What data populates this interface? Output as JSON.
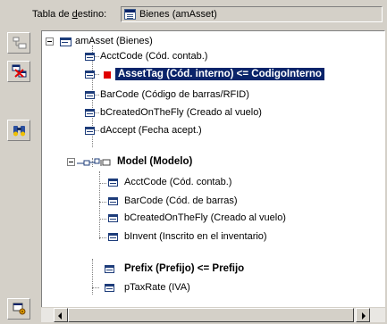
{
  "target": {
    "label_prefix": "Tabla de ",
    "label_underlined": "d",
    "label_suffix": "estino:",
    "value": "Bienes (amAsset)",
    "icon": "table-icon"
  },
  "toolbar": [
    {
      "name": "tree-view-button",
      "icon": "tree-icon"
    },
    {
      "name": "remove-link-button",
      "icon": "remove-icon"
    },
    {
      "name": "find-button",
      "icon": "binoculars-icon"
    },
    {
      "name": "bottom-tool-button",
      "icon": "tool-icon"
    }
  ],
  "tree": {
    "root": "amAsset (Bienes)",
    "fields": [
      "AcctCode (Cód. contab.)",
      "AssetTag (Cód. interno)  <=  CodigoInterno",
      "BarCode (Código de barras/RFID)",
      "bCreatedOnTheFly (Creado al vuelo)",
      "dAccept (Fecha acept.)"
    ],
    "model_link": "Model (Modelo)",
    "model_fields": [
      "AcctCode (Cód. contab.)",
      "BarCode (Cód. de barras)",
      "bCreatedOnTheFly (Creado al vuelo)",
      "bInvent (Inscrito en el inventario)"
    ],
    "prefix_link": "Prefix (Prefijo)  <=  Prefijo",
    "prefix_fields": [
      "pTaxRate (IVA)"
    ]
  },
  "colors": {
    "selection": "#0a246a",
    "mapped_marker": "#e00000",
    "window_bg": "#d4d0c8"
  }
}
